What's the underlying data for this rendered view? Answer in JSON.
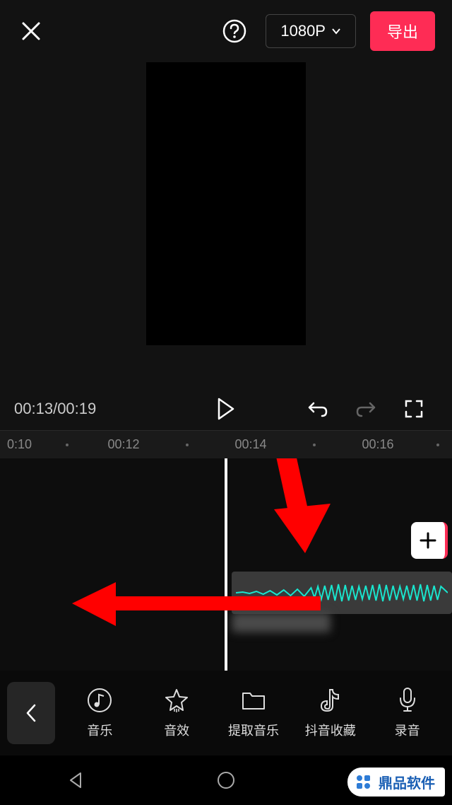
{
  "topbar": {
    "resolution": "1080P",
    "export": "导出"
  },
  "playback": {
    "current": "00:13",
    "total": "00:19",
    "separator": "/"
  },
  "ruler": {
    "labels": [
      {
        "text": "0:10",
        "pos": 10
      },
      {
        "text": "00:12",
        "pos": 175
      },
      {
        "text": "00:14",
        "pos": 355
      },
      {
        "text": "00:16",
        "pos": 535
      }
    ],
    "dots": [
      95,
      265,
      445,
      620
    ]
  },
  "toolbar": {
    "music": "音乐",
    "sfx": "音效",
    "extract": "提取音乐",
    "douyin": "抖音收藏",
    "record": "录音"
  },
  "watermark": {
    "text": "鼎品软件"
  }
}
